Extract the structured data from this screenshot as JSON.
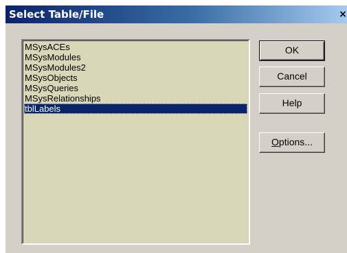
{
  "dialog": {
    "title": "Select Table/File",
    "close_glyph": "×"
  },
  "list": {
    "items": [
      {
        "label": "MSysACEs"
      },
      {
        "label": "MSysModules"
      },
      {
        "label": "MSysModules2"
      },
      {
        "label": "MSysObjects"
      },
      {
        "label": "MSysQueries"
      },
      {
        "label": "MSysRelationships"
      },
      {
        "label": "tblLabels",
        "selected": true
      }
    ],
    "background_color": "#d8d7b7",
    "selection_color": "#0a246a"
  },
  "buttons": {
    "ok_label": "OK",
    "cancel_label": "Cancel",
    "help_label": "Help",
    "options_mnemonic": "O",
    "options_rest": "ptions..."
  },
  "colors": {
    "titlebar_start": "#0a246a",
    "titlebar_end": "#a6caf0",
    "dialog_face": "#d4d0c8"
  }
}
